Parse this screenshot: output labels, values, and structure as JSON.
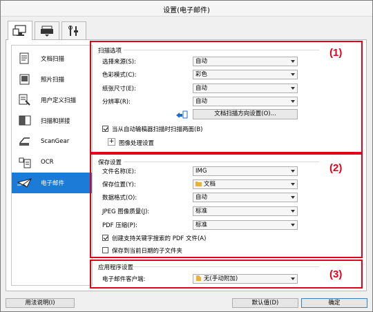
{
  "window": {
    "title": "设置(电子邮件)"
  },
  "tabs": [
    {
      "icon": "scan-from-computer-icon",
      "active": true
    },
    {
      "icon": "scan-from-operation-panel-icon",
      "active": false
    },
    {
      "icon": "general-settings-icon",
      "active": false
    }
  ],
  "sidebar": {
    "items": [
      {
        "label": "文档扫描",
        "icon": "document-scan-icon"
      },
      {
        "label": "照片扫描",
        "icon": "photo-scan-icon"
      },
      {
        "label": "用户定义扫描",
        "icon": "custom-scan-icon"
      },
      {
        "label": "扫描和拼接",
        "icon": "scan-and-stitch-icon"
      },
      {
        "label": "ScanGear",
        "icon": "scangear-icon"
      },
      {
        "label": "OCR",
        "icon": "ocr-icon"
      },
      {
        "label": "电子邮件",
        "icon": "email-icon",
        "active": true
      }
    ]
  },
  "scan_options": {
    "title": "扫描选项",
    "number": "(1)",
    "select_source_label": "选择来源(S):",
    "select_source_value": "自动",
    "color_mode_label": "色彩模式(C):",
    "color_mode_value": "彩色",
    "paper_size_label": "纸张尺寸(E):",
    "paper_size_value": "自动",
    "resolution_label": "分辨率(R):",
    "resolution_value": "自动",
    "orientation_button": "文档扫描方向设置(O)...",
    "adf_checkbox_label": "当从自动输稿器扫描时扫描两面(B)",
    "adf_checked": true,
    "image_processing_label": "图像处理设置",
    "expand_symbol": "+"
  },
  "save_settings": {
    "title": "保存设置",
    "number": "(2)",
    "file_name_label": "文件名称(E):",
    "file_name_value": "IMG",
    "save_in_label": "保存位置(Y):",
    "save_in_value": "文档",
    "data_format_label": "数据格式(O):",
    "data_format_value": "自动",
    "jpeg_quality_label": "JPEG 图像质量(J):",
    "jpeg_quality_value": "标准",
    "pdf_compression_label": "PDF 压缩(P):",
    "pdf_compression_value": "标准",
    "keyword_pdf_label": "创建支持关键字搜索的 PDF 文件(A)",
    "keyword_pdf_checked": true,
    "subfolder_label": "保存到当前日期的子文件夹",
    "subfolder_checked": false
  },
  "app_settings": {
    "title": "应用程序设置",
    "number": "(3)",
    "email_client_label": "电子邮件客户端:",
    "email_client_value": "无(手动附加)"
  },
  "footer": {
    "help_button": "用法说明(I)",
    "defaults_button": "默认值(D)",
    "ok_button": "确定"
  },
  "colors": {
    "accent_red": "#e0001b",
    "selected_blue": "#1b7bd6"
  }
}
